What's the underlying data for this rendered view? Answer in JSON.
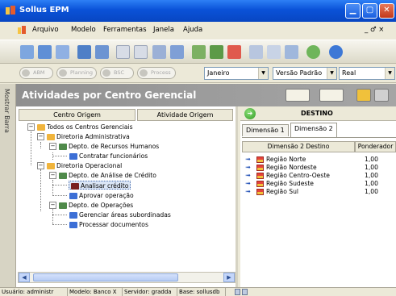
{
  "window": {
    "title": "Sollus EPM"
  },
  "menu": {
    "items": [
      "Arquivo",
      "Modelo",
      "Ferramentas",
      "Janela",
      "Ajuda"
    ],
    "right_controls": "_ ♂ ×"
  },
  "toolbar2": {
    "pills": [
      "ABM",
      "Planning",
      "BSC",
      "Process"
    ],
    "month": "Janeiro",
    "version": "Versão Padrão",
    "currency": "Real"
  },
  "side_strip": {
    "label": "Mostrar Barra"
  },
  "panel": {
    "title": "Atividades por Centro Gerencial"
  },
  "left": {
    "col_origin": "Centro Origem",
    "col_activity": "Atividade Origem",
    "tree": [
      {
        "label": "Todos os Centros Gerenciais"
      },
      {
        "label": "Diretoria Administrativa"
      },
      {
        "label": "Depto. de Recursos Humanos"
      },
      {
        "label": "Contratar funcionários"
      },
      {
        "label": "Diretoria Operacional"
      },
      {
        "label": "Depto. de Análise de Crédito"
      },
      {
        "label": "Analisar crédito"
      },
      {
        "label": "Aprovar operação"
      },
      {
        "label": "Depto. de Operações"
      },
      {
        "label": "Gerenciar áreas subordinadas"
      },
      {
        "label": "Processar documentos"
      }
    ]
  },
  "right": {
    "destination_title": "DESTINO",
    "tabs": [
      "Dimensão 1",
      "Dimensão 2"
    ],
    "grid_header_name": "Dimensão 2 Destino",
    "grid_header_weight": "Ponderador",
    "rows": [
      {
        "name": "Região Norte",
        "weight": "1,00"
      },
      {
        "name": "Região Nordeste",
        "weight": "1,00"
      },
      {
        "name": "Região Centro-Oeste",
        "weight": "1,00"
      },
      {
        "name": "Região Sudeste",
        "weight": "1,00"
      },
      {
        "name": "Região Sul",
        "weight": "1,00"
      }
    ]
  },
  "status": {
    "user": "Usuário: administr",
    "model": "Modelo: Banco X",
    "server": "Servidor: gradda",
    "base": "Base: sollusdb"
  },
  "colors": {
    "title_blue": "#0a52d8",
    "panel_header_gray": "#9c9c9c",
    "selection": "#dbe6f6",
    "folder_orange": "#f0b43c",
    "activity_blue": "#3c6fd6"
  }
}
